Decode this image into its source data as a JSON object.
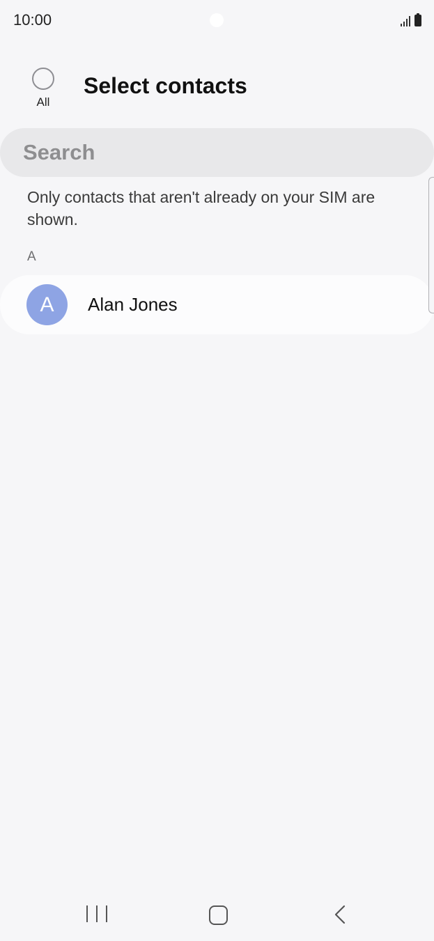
{
  "status_bar": {
    "time": "10:00"
  },
  "header": {
    "select_all_label": "All",
    "title": "Select contacts"
  },
  "search": {
    "placeholder": "Search"
  },
  "info": {
    "text": "Only contacts that aren't already on your SIM are shown."
  },
  "contacts": {
    "sections": [
      {
        "letter": "A",
        "items": [
          {
            "initial": "A",
            "name": "Alan Jones",
            "avatar_color": "#8ea4e4",
            "selected": false
          }
        ]
      }
    ]
  },
  "icons": {
    "signal": "signal-icon",
    "battery": "battery-icon",
    "recents": "recents-icon",
    "home": "home-icon",
    "back": "back-icon"
  },
  "colors": {
    "background": "#f6f6f8",
    "search_background": "#e8e8ea",
    "avatar": "#8ea4e4",
    "title": "#111111"
  }
}
